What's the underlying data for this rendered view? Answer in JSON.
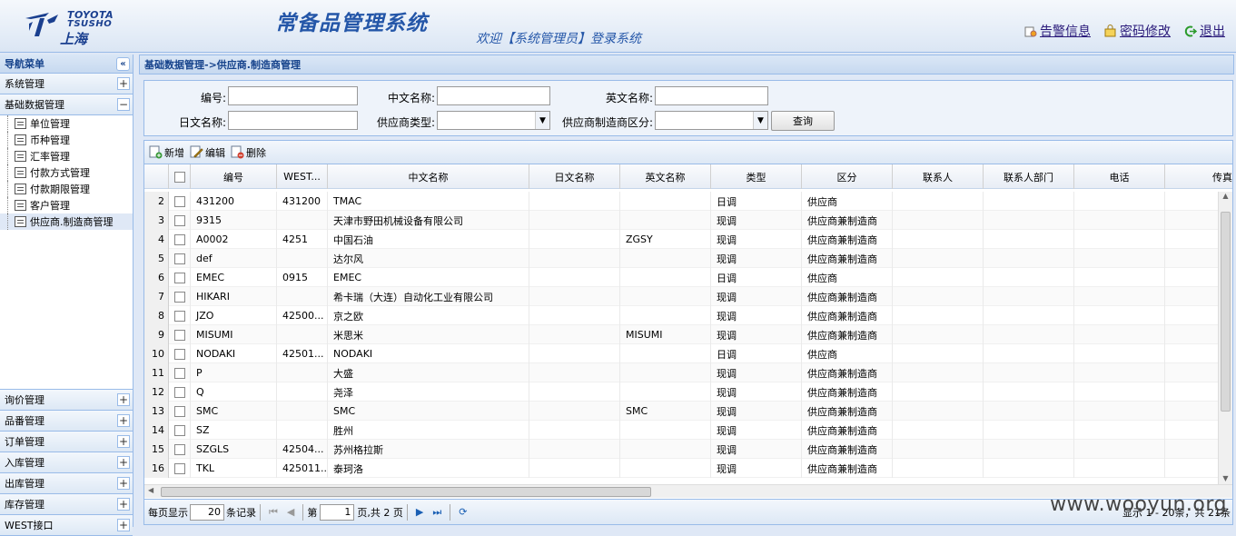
{
  "header": {
    "logo_line1": "TOYOTA",
    "logo_line2": "TSUSHO",
    "logo_line3": "上海",
    "system_title": "常备品管理系统",
    "welcome": "欢迎【系统管理员】登录系统",
    "links": [
      {
        "icon": "alarm-icon",
        "label": "告警信息"
      },
      {
        "icon": "lock-icon",
        "label": "密码修改"
      },
      {
        "icon": "logout-icon",
        "label": "退出"
      }
    ]
  },
  "sidebar": {
    "title": "导航菜单",
    "groups_top": [
      {
        "label": "系统管理",
        "state": "+"
      },
      {
        "label": "基础数据管理",
        "state": "−"
      }
    ],
    "tree": [
      {
        "label": "单位管理"
      },
      {
        "label": "币种管理"
      },
      {
        "label": "汇率管理"
      },
      {
        "label": "付款方式管理"
      },
      {
        "label": "付款期限管理"
      },
      {
        "label": "客户管理"
      },
      {
        "label": "供应商.制造商管理",
        "selected": true
      }
    ],
    "groups_bottom": [
      {
        "label": "询价管理"
      },
      {
        "label": "品番管理"
      },
      {
        "label": "订单管理"
      },
      {
        "label": "入库管理"
      },
      {
        "label": "出库管理"
      },
      {
        "label": "库存管理"
      },
      {
        "label": "WEST接口"
      }
    ]
  },
  "breadcrumb": "基础数据管理->供应商.制造商管理",
  "search": {
    "code_label": "编号:",
    "cn_name_label": "中文名称:",
    "en_name_label": "英文名称:",
    "jp_name_label": "日文名称:",
    "type_label": "供应商类型:",
    "category_label": "供应商制造商区分:",
    "query_button": "查询"
  },
  "toolbar": {
    "add": "新增",
    "edit": "编辑",
    "delete": "删除"
  },
  "columns": [
    "编号",
    "WEST...",
    "中文名称",
    "日文名称",
    "英文名称",
    "类型",
    "区分",
    "联系人",
    "联系人部门",
    "电话",
    "传真"
  ],
  "rows": [
    {
      "n": "2",
      "code": "431200",
      "west": "431200",
      "cn": "TMAC",
      "jp": "",
      "en": "",
      "type": "日调",
      "cat": "供应商"
    },
    {
      "n": "3",
      "code": "9315",
      "west": "",
      "cn": "天津市野田机械设备有限公司",
      "jp": "",
      "en": "",
      "type": "现调",
      "cat": "供应商兼制造商"
    },
    {
      "n": "4",
      "code": "A0002",
      "west": "4251",
      "cn": "中国石油",
      "jp": "",
      "en": "ZGSY",
      "type": "现调",
      "cat": "供应商兼制造商"
    },
    {
      "n": "5",
      "code": "def",
      "west": "",
      "cn": "达尔风",
      "jp": "",
      "en": "",
      "type": "现调",
      "cat": "供应商兼制造商"
    },
    {
      "n": "6",
      "code": "EMEC",
      "west": "0915",
      "cn": "EMEC",
      "jp": "",
      "en": "",
      "type": "日调",
      "cat": "供应商"
    },
    {
      "n": "7",
      "code": "HIKARI",
      "west": "",
      "cn": "希卡瑞（大连）自动化工业有限公司",
      "jp": "",
      "en": "",
      "type": "现调",
      "cat": "供应商兼制造商"
    },
    {
      "n": "8",
      "code": "JZO",
      "west": "42500...",
      "cn": "京之欧",
      "jp": "",
      "en": "",
      "type": "现调",
      "cat": "供应商兼制造商"
    },
    {
      "n": "9",
      "code": "MISUMI",
      "west": "",
      "cn": "米思米",
      "jp": "",
      "en": "MISUMI",
      "type": "现调",
      "cat": "供应商兼制造商"
    },
    {
      "n": "10",
      "code": "NODAKI",
      "west": "42501...",
      "cn": "NODAKI",
      "jp": "",
      "en": "",
      "type": "日调",
      "cat": "供应商"
    },
    {
      "n": "11",
      "code": "P",
      "west": "",
      "cn": "大盛",
      "jp": "",
      "en": "",
      "type": "现调",
      "cat": "供应商兼制造商"
    },
    {
      "n": "12",
      "code": "Q",
      "west": "",
      "cn": "尧泽",
      "jp": "",
      "en": "",
      "type": "现调",
      "cat": "供应商兼制造商"
    },
    {
      "n": "13",
      "code": "SMC",
      "west": "",
      "cn": "SMC",
      "jp": "",
      "en": "SMC",
      "type": "现调",
      "cat": "供应商兼制造商"
    },
    {
      "n": "14",
      "code": "SZ",
      "west": "",
      "cn": "胜州",
      "jp": "",
      "en": "",
      "type": "现调",
      "cat": "供应商兼制造商"
    },
    {
      "n": "15",
      "code": "SZGLS",
      "west": "42504...",
      "cn": "苏州格拉斯",
      "jp": "",
      "en": "",
      "type": "现调",
      "cat": "供应商兼制造商"
    },
    {
      "n": "16",
      "code": "TKL",
      "west": "425011...",
      "cn": "泰珂洛",
      "jp": "",
      "en": "",
      "type": "现调",
      "cat": "供应商兼制造商"
    }
  ],
  "pager": {
    "per_page_label": "每页显示",
    "per_page_value": "20",
    "records_label": "条记录",
    "page_prefix": "第",
    "page_value": "1",
    "page_suffix": "页,共 2 页",
    "info": "显示 1 - 20条，共 21条"
  },
  "watermark": "www.wooyun.org"
}
